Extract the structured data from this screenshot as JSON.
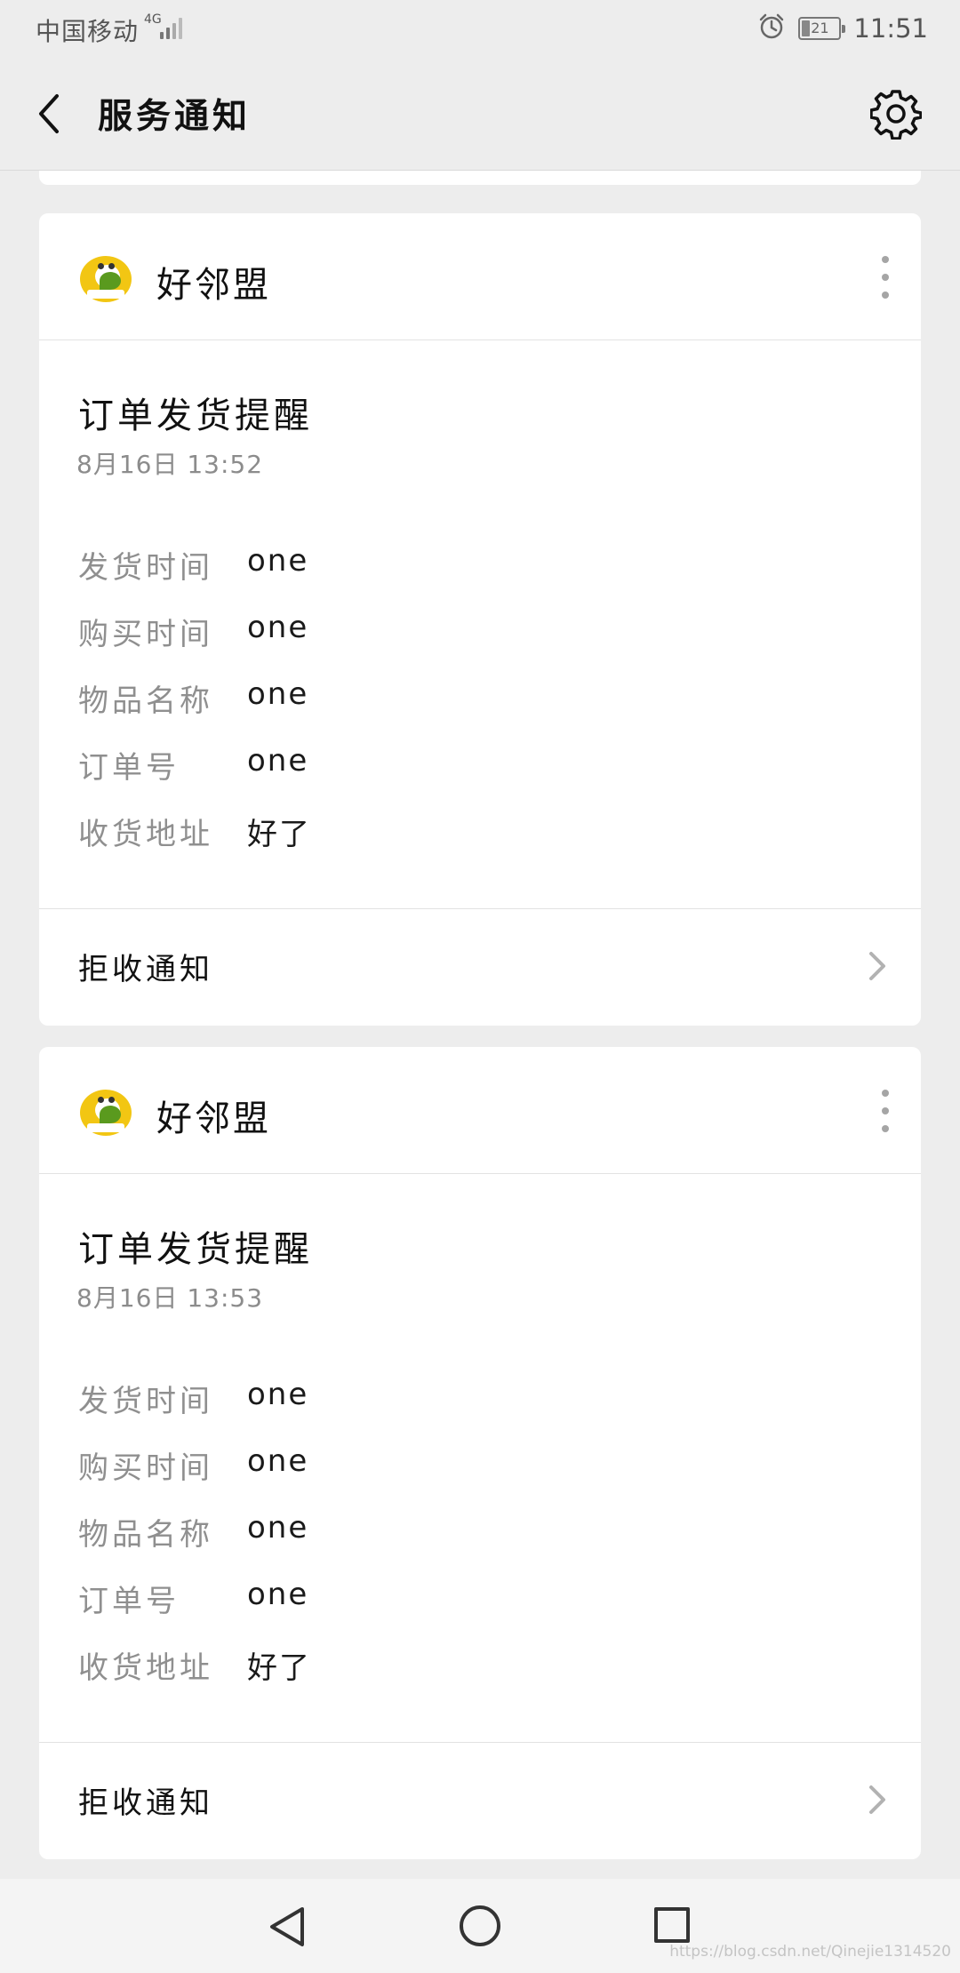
{
  "status_bar": {
    "carrier": "中国移动",
    "network": "4G",
    "battery": "21",
    "time": "11:51"
  },
  "header": {
    "title": "服务通知"
  },
  "cards": [
    {
      "merchant": "好邻盟",
      "title": "订单发货提醒",
      "time": "8月16日 13:52",
      "fields": [
        {
          "label": "发货时间",
          "value": "one"
        },
        {
          "label": "购买时间",
          "value": "one"
        },
        {
          "label": "物品名称",
          "value": "one"
        },
        {
          "label": "订单号",
          "value": "one"
        },
        {
          "label": "收货地址",
          "value": "好了"
        }
      ],
      "footer_label": "拒收通知"
    },
    {
      "merchant": "好邻盟",
      "title": "订单发货提醒",
      "time": "8月16日 13:53",
      "fields": [
        {
          "label": "发货时间",
          "value": "one"
        },
        {
          "label": "购买时间",
          "value": "one"
        },
        {
          "label": "物品名称",
          "value": "one"
        },
        {
          "label": "订单号",
          "value": "one"
        },
        {
          "label": "收货地址",
          "value": "好了"
        }
      ],
      "footer_label": "拒收通知"
    }
  ],
  "watermark": "https://blog.csdn.net/Qinejie1314520",
  "icons": {
    "back": "chevron-left-icon",
    "settings": "gear-icon",
    "more": "vertical-ellipsis-icon",
    "footer": "chevron-right-icon",
    "alarm": "alarm-clock-icon",
    "signal": "signal-icon",
    "battery": "battery-icon"
  },
  "colors": {
    "background": "#ededed",
    "card": "#ffffff",
    "label_gray": "#8f8f8f",
    "text": "#111111",
    "avatar_yellow": "#f2c613",
    "avatar_green": "#5a9a1e"
  }
}
